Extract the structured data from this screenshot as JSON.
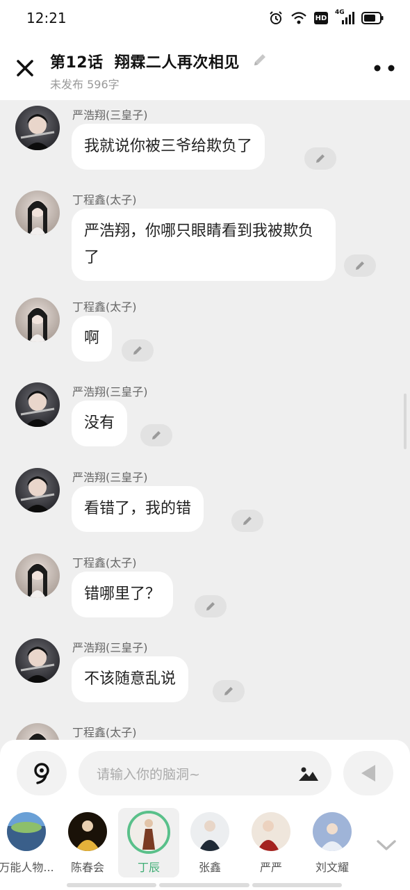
{
  "status_bar": {
    "time": "12:21",
    "icons": [
      "alarm-icon",
      "wifi-icon",
      "hd-icon",
      "4g-signal-icon",
      "battery-icon"
    ],
    "hd_label": "HD",
    "network_label": "4G"
  },
  "header": {
    "title": "第12话  翔霖二人再次相见",
    "subtitle": "未发布 596字",
    "icons": [
      "close-icon",
      "pencil-icon",
      "more-icon"
    ]
  },
  "messages": [
    {
      "speaker": "严浩翔(三皇子)",
      "text": "我就说你被三爷给欺负了"
    },
    {
      "speaker": "丁程鑫(太子)",
      "text": "严浩翔，你哪只眼睛看到我被欺负了"
    },
    {
      "speaker": "丁程鑫(太子)",
      "text": "啊"
    },
    {
      "speaker": "严浩翔(三皇子)",
      "text": "没有"
    },
    {
      "speaker": "严浩翔(三皇子)",
      "text": "看错了，我的错"
    },
    {
      "speaker": "丁程鑫(太子)",
      "text": "错哪里了？"
    },
    {
      "speaker": "严浩翔(三皇子)",
      "text": "不该随意乱说"
    },
    {
      "speaker": "丁程鑫(太子)",
      "text": ""
    }
  ],
  "composer": {
    "placeholder": "请输入你的脑洞~",
    "icons": [
      "voice-icon",
      "image-icon",
      "send-icon"
    ]
  },
  "characters": [
    {
      "name": "万能人物...",
      "active": false
    },
    {
      "name": "陈春会",
      "active": false
    },
    {
      "name": "丁辰",
      "active": true
    },
    {
      "name": "张鑫",
      "active": false
    },
    {
      "name": "严严",
      "active": false
    },
    {
      "name": "刘文耀",
      "active": false
    }
  ],
  "colors": {
    "accent": "#3fae75",
    "background": "#efefef",
    "bubble": "#ffffff"
  }
}
